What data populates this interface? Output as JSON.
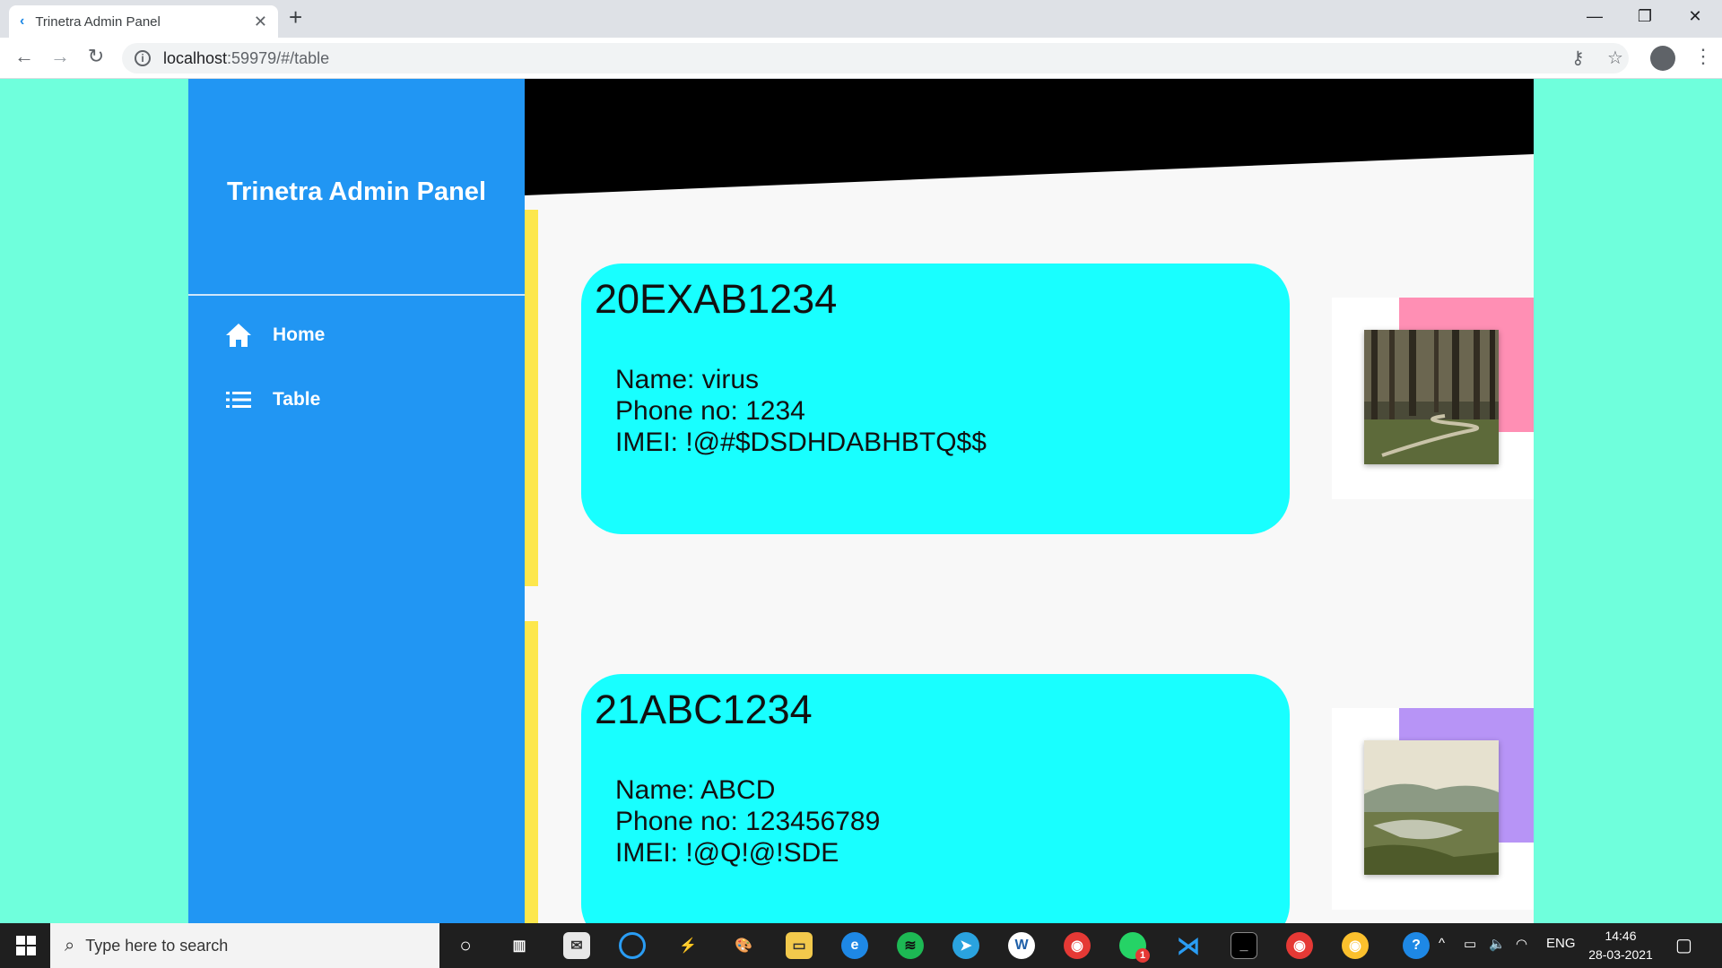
{
  "browser": {
    "tab_title": "Trinetra Admin Panel",
    "url_host": "localhost",
    "url_path": ":59979/#/table"
  },
  "sidebar": {
    "brand": "Trinetra Admin Panel",
    "items": [
      {
        "label": "Home",
        "icon": "home-icon"
      },
      {
        "label": "Table",
        "icon": "list-icon"
      }
    ]
  },
  "records": [
    {
      "id": "20EXAB1234",
      "name_line": "Name: virus",
      "phone_line": "Phone no: 1234",
      "imei_line": "IMEI: !@#$DSDHDABHBTQ$$",
      "accent_color": "#ff8fb4",
      "image": "forest-path"
    },
    {
      "id": "21ABC1234",
      "name_line": "Name: ABCD",
      "phone_line": "Phone no: 123456789",
      "imei_line": "IMEI: !@Q!@!SDE",
      "accent_color": "#b794f6",
      "image": "lake-landscape"
    }
  ],
  "taskbar": {
    "search_placeholder": "Type here to search",
    "language": "ENG",
    "time": "14:46",
    "date": "28-03-2021",
    "whatsapp_badge": "1"
  },
  "colors": {
    "page_bg": "#6fffdc",
    "sidebar_bg": "#2196f3",
    "card_bg": "#18ffff",
    "accent_bar": "#fde74c"
  }
}
